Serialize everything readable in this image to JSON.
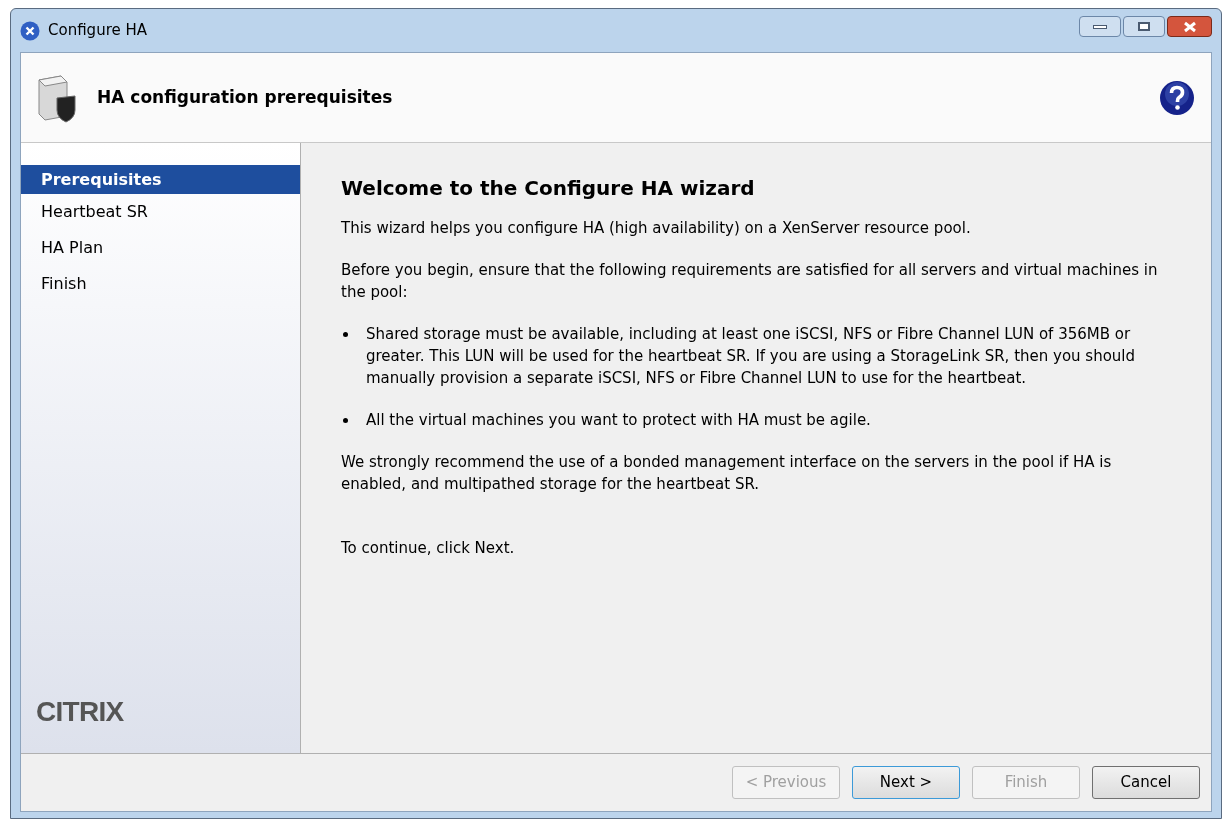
{
  "window": {
    "title": "Configure HA"
  },
  "header": {
    "title": "HA configuration prerequisites"
  },
  "sidebar": {
    "items": [
      {
        "label": "Prerequisites",
        "selected": true
      },
      {
        "label": "Heartbeat SR",
        "selected": false
      },
      {
        "label": "HA Plan",
        "selected": false
      },
      {
        "label": "Finish",
        "selected": false
      }
    ],
    "logo": "CITRIX"
  },
  "content": {
    "heading": "Welcome to the Configure HA wizard",
    "paragraphs": [
      {
        "kind": "text",
        "text": "This wizard helps you configure HA (high availability) on a XenServer resource pool."
      },
      {
        "kind": "text",
        "text": "Before you begin, ensure that the following requirements are satisfied for all servers and virtual machines in the pool:"
      },
      {
        "kind": "bullet",
        "text": "Shared storage must be available, including at least one iSCSI, NFS or Fibre Channel LUN of 356MB or greater. This LUN will be used for the heartbeat SR. If you are using a StorageLink SR, then you should manually provision a separate iSCSI, NFS or Fibre Channel LUN to use for the heartbeat."
      },
      {
        "kind": "bullet",
        "text": "All the virtual machines you want to protect with HA must be agile."
      },
      {
        "kind": "text",
        "text": "We strongly recommend the use of a bonded management interface on the servers in the pool if HA is enabled, and multipathed storage for the heartbeat SR."
      },
      {
        "kind": "spaced",
        "text": "To continue, click Next."
      }
    ]
  },
  "buttons": [
    {
      "label": "< Previous",
      "disabled": true,
      "default": false
    },
    {
      "label": "Next >",
      "disabled": false,
      "default": true
    },
    {
      "label": "Finish",
      "disabled": true,
      "default": false
    },
    {
      "label": "Cancel",
      "disabled": false,
      "default": false
    }
  ]
}
